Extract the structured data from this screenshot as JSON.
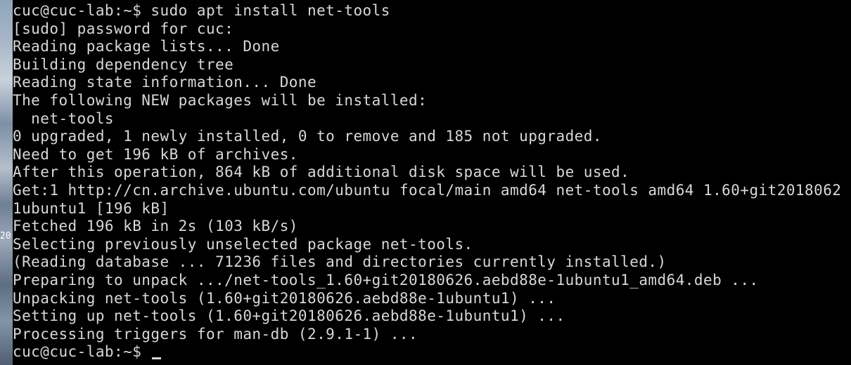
{
  "wallpaper": {
    "visible_text": "20"
  },
  "terminal": {
    "lines": [
      "cuc@cuc-lab:~$ sudo apt install net-tools",
      "[sudo] password for cuc:",
      "Reading package lists... Done",
      "Building dependency tree",
      "Reading state information... Done",
      "The following NEW packages will be installed:",
      "  net-tools",
      "0 upgraded, 1 newly installed, 0 to remove and 185 not upgraded.",
      "Need to get 196 kB of archives.",
      "After this operation, 864 kB of additional disk space will be used.",
      "Get:1 http://cn.archive.ubuntu.com/ubuntu focal/main amd64 net-tools amd64 1.60+git2018062",
      "1ubuntu1 [196 kB]",
      "Fetched 196 kB in 2s (103 kB/s)",
      "Selecting previously unselected package net-tools.",
      "(Reading database ... 71236 files and directories currently installed.)",
      "Preparing to unpack .../net-tools_1.60+git20180626.aebd88e-1ubuntu1_amd64.deb ...",
      "Unpacking net-tools (1.60+git20180626.aebd88e-1ubuntu1) ...",
      "Setting up net-tools (1.60+git20180626.aebd88e-1ubuntu1) ...",
      "Processing triggers for man-db (2.9.1-1) ...",
      "cuc@cuc-lab:~$ "
    ]
  },
  "colors": {
    "background": "#000000",
    "foreground": "#d8d8d8"
  }
}
